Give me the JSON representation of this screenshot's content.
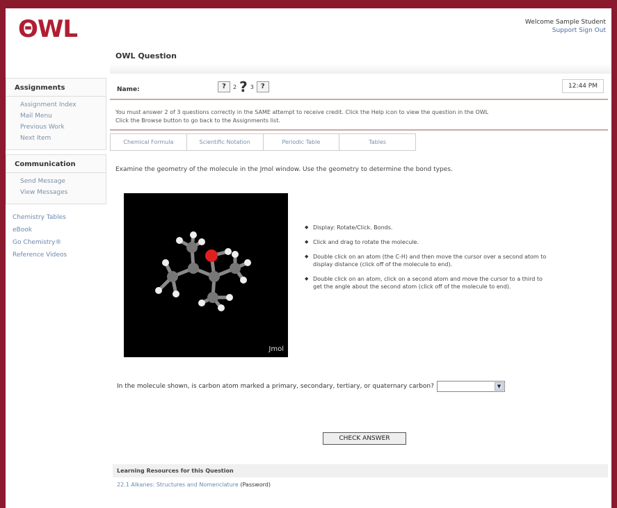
{
  "header": {
    "logo_text": "ΘWL",
    "welcome_line": "Welcome Sample Student",
    "welcome_links": "Support Sign Out",
    "page_title": "OWL Question"
  },
  "sidebar": {
    "assignments_title": "Assignments",
    "assignment_items": [
      "Assignment Index",
      "Mail Menu",
      "Previous Work",
      "Next Item"
    ],
    "communication_title": "Communication",
    "communication_items": [
      "Send Message",
      "View Messages"
    ],
    "links": [
      "Chemistry Tables",
      "eBook",
      "Go Chemistry®",
      "Reference Videos"
    ]
  },
  "question_header": {
    "name_label": "Name:",
    "help_icons": [
      "?",
      "?",
      "?"
    ],
    "time": "12:44 PM"
  },
  "notice": {
    "line1": "You must answer 2 of 3 questions correctly in the SAME attempt to receive credit. Click the Help icon to view the question in the OWL",
    "line2": "Click the Browse button to go back to the Assignments list."
  },
  "tabs": [
    "Chemical Formula",
    "Scientific Notation",
    "Periodic Table",
    "Tables"
  ],
  "question_text": "Examine the geometry of the molecule in the Jmol window. Use the geometry to determine the bond types.",
  "jmol_label": "Jmol",
  "instructions": [
    "Display: Rotate/Click. Bonds.",
    "Click and drag to rotate the molecule.",
    "Double click on an atom (the C-H) and then move the cursor over a second atom to display distance (click off of the molecule to end).",
    "Double click on an atom, click on a second atom and move the cursor to a third to get the angle about the second atom (click off of the molecule to end)."
  ],
  "answer": {
    "prompt": "In the molecule shown, is carbon atom marked a primary, secondary, tertiary, or quaternary carbon?",
    "selected": ""
  },
  "check_button": "CHECK ANSWER",
  "resources": {
    "heading": "Learning Resources for this Question",
    "item_link": "22.1 Alkanes: Structures and Nomenclature",
    "item_suffix": " (Password)"
  }
}
